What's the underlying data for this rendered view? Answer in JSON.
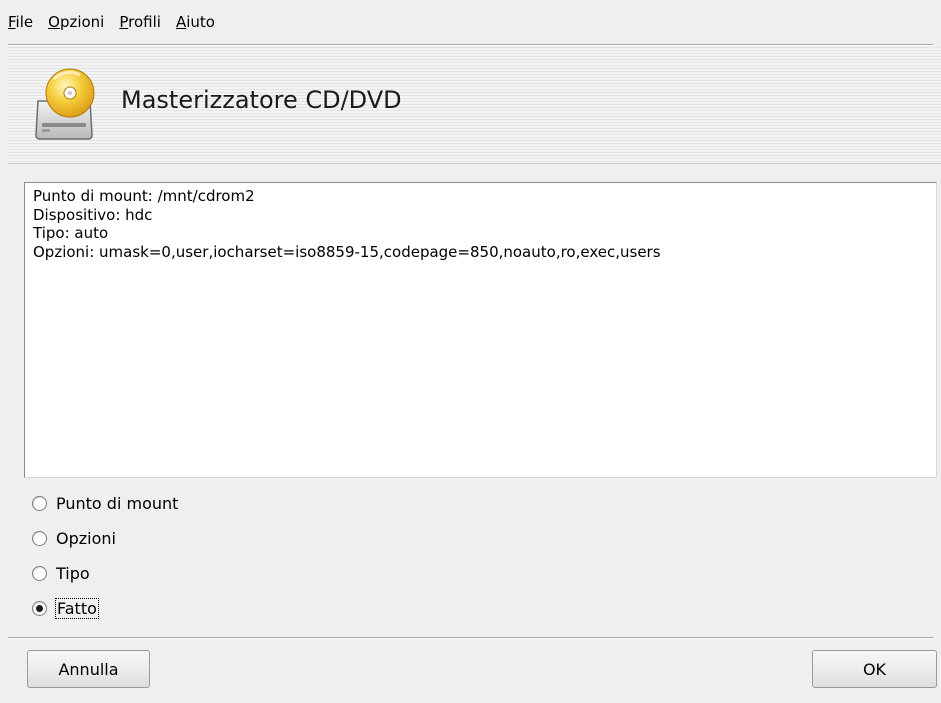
{
  "menu": {
    "items": [
      {
        "label": "File",
        "accel": "F",
        "rest": "ile"
      },
      {
        "label": "Opzioni",
        "accel": "O",
        "rest": "pzioni"
      },
      {
        "label": "Profili",
        "accel": "P",
        "rest": "rofili"
      },
      {
        "label": "Aiuto",
        "accel": "A",
        "rest": "iuto"
      }
    ]
  },
  "header": {
    "title": "Masterizzatore CD/DVD",
    "icon": "cd-burner-drive-icon"
  },
  "info": {
    "lines": [
      "Punto di mount: /mnt/cdrom2",
      "Dispositivo: hdc",
      "Tipo: auto",
      "Opzioni: umask=0,user,iocharset=iso8859-15,codepage=850,noauto,ro,exec,users"
    ]
  },
  "options": {
    "items": [
      {
        "label": "Punto di mount",
        "checked": false
      },
      {
        "label": "Opzioni",
        "checked": false
      },
      {
        "label": "Tipo",
        "checked": false
      },
      {
        "label": "Fatto",
        "checked": true
      }
    ]
  },
  "buttons": {
    "cancel_label": "Annulla",
    "ok_label": "OK"
  },
  "colors": {
    "background": "#efefef",
    "disc_gold": "#f2c12e",
    "text": "#000000"
  }
}
